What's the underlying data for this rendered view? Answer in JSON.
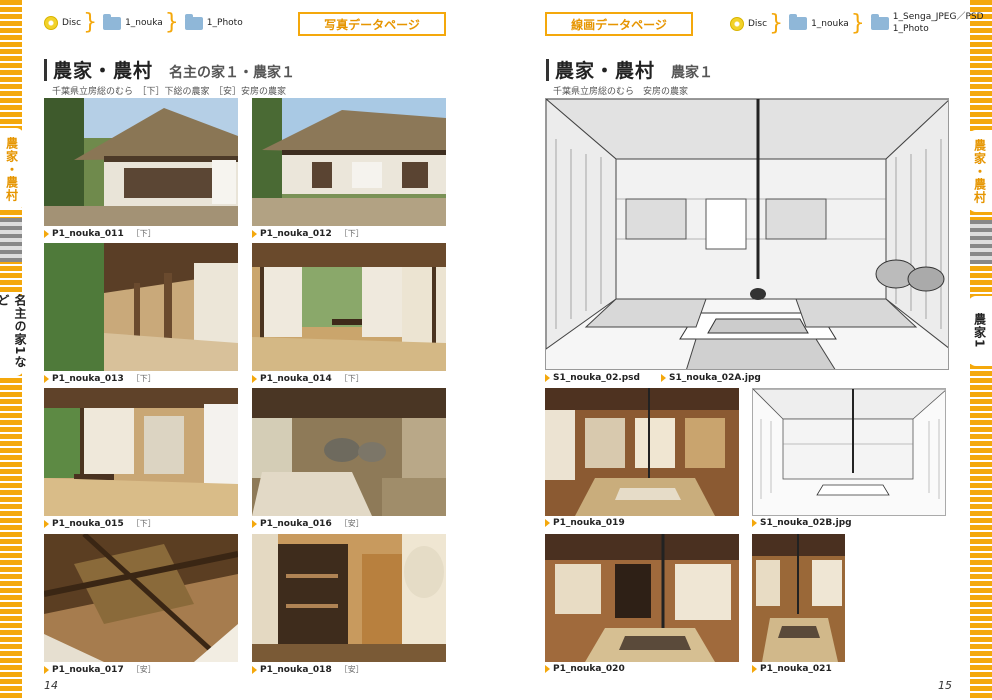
{
  "left_page": {
    "breadcrumb": [
      "Disc",
      "1_nouka",
      "1_Photo"
    ],
    "tag": "写真データページ",
    "title": "農家・農村",
    "subtitle": "名主の家１・農家１",
    "subline": "千葉県立房総のむら　［下］下総の農家　［安］安房の農家",
    "side_tab_1": "農家・農村",
    "side_tab_2": "名主の家1など",
    "photos": [
      {
        "name": "P1_nouka_011",
        "tag": "［下］"
      },
      {
        "name": "P1_nouka_012",
        "tag": "［下］"
      },
      {
        "name": "P1_nouka_013",
        "tag": "［下］"
      },
      {
        "name": "P1_nouka_014",
        "tag": "［下］"
      },
      {
        "name": "P1_nouka_015",
        "tag": "［下］"
      },
      {
        "name": "P1_nouka_016",
        "tag": "［安］"
      },
      {
        "name": "P1_nouka_017",
        "tag": "［安］"
      },
      {
        "name": "P1_nouka_018",
        "tag": "［安］"
      }
    ],
    "page_number": "14"
  },
  "right_page": {
    "breadcrumb": [
      "Disc",
      "1_nouka",
      "1_Senga_JPEG／PSD",
      "1_Photo"
    ],
    "tag": "線画データページ",
    "title": "農家・農村",
    "subtitle": "農家１",
    "subline": "千葉県立房総のむら　安房の農家",
    "side_tab_1": "農家・農村",
    "side_tab_2": "農家1",
    "big_caption_1": "S1_nouka_02.psd",
    "big_caption_2": "S1_nouka_02A.jpg",
    "photos": [
      {
        "name": "P1_nouka_019"
      },
      {
        "name": "S1_nouka_02B.jpg"
      },
      {
        "name": "P1_nouka_020"
      },
      {
        "name": "P1_nouka_021"
      }
    ],
    "page_number": "15"
  }
}
